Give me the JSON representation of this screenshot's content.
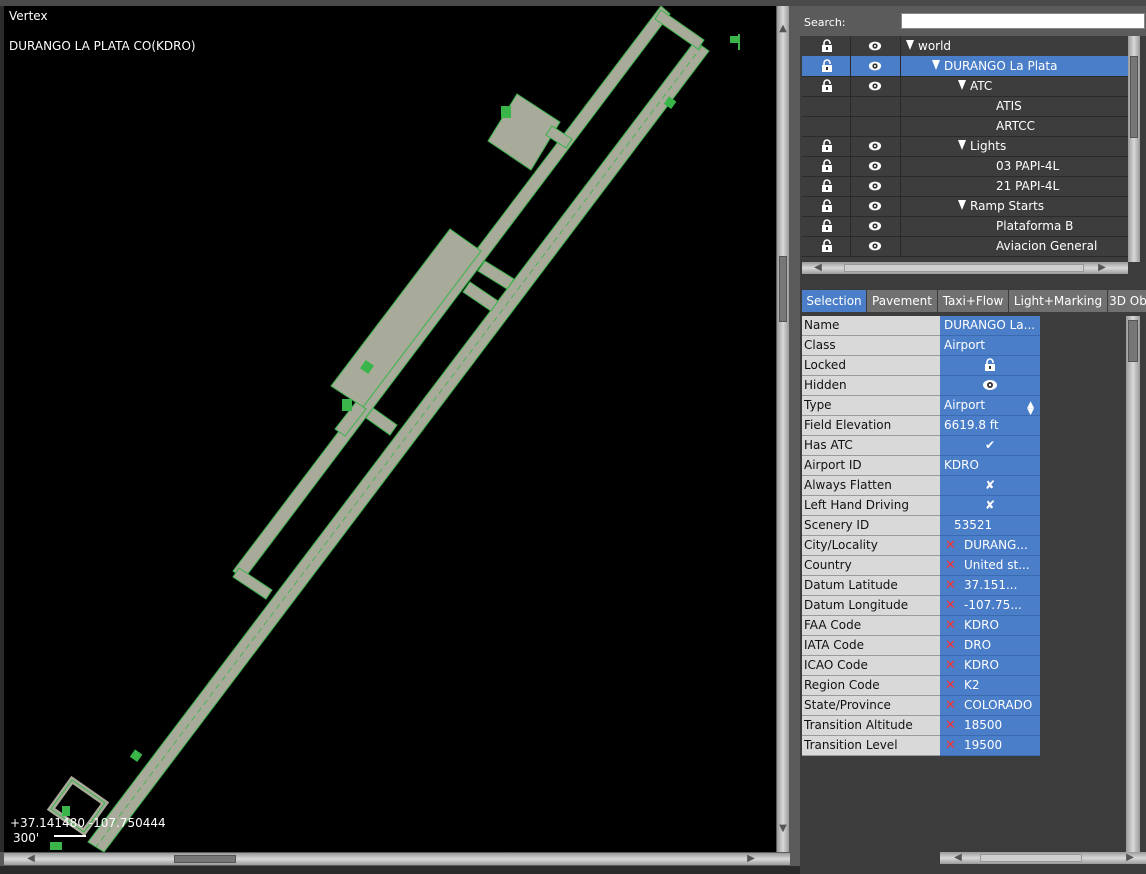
{
  "map": {
    "tool_name": "Vertex",
    "airport_label": "DURANGO LA PLATA CO(KDRO)",
    "cursor_coords": "+37.141480 -107.750444",
    "scale_label": "300'"
  },
  "search": {
    "label": "Search:",
    "value": ""
  },
  "tree": {
    "rows": [
      {
        "label": "world",
        "icons": true,
        "triangle": true,
        "indent": 0,
        "selected": false
      },
      {
        "label": "DURANGO La Plata",
        "icons": true,
        "triangle": true,
        "indent": 1,
        "selected": true
      },
      {
        "label": "ATC",
        "icons": true,
        "triangle": true,
        "indent": 2,
        "selected": false
      },
      {
        "label": "ATIS",
        "icons": false,
        "triangle": false,
        "indent": 3,
        "selected": false
      },
      {
        "label": "ARTCC",
        "icons": false,
        "triangle": false,
        "indent": 3,
        "selected": false
      },
      {
        "label": "Lights",
        "icons": true,
        "triangle": true,
        "indent": 2,
        "selected": false
      },
      {
        "label": "03  PAPI-4L",
        "icons": true,
        "triangle": false,
        "indent": 3,
        "selected": false
      },
      {
        "label": "21  PAPI-4L",
        "icons": true,
        "triangle": false,
        "indent": 3,
        "selected": false
      },
      {
        "label": "Ramp Starts",
        "icons": true,
        "triangle": true,
        "indent": 2,
        "selected": false
      },
      {
        "label": "Plataforma B",
        "icons": true,
        "triangle": false,
        "indent": 3,
        "selected": false
      },
      {
        "label": "Aviacion General",
        "icons": true,
        "triangle": false,
        "indent": 3,
        "selected": false
      }
    ]
  },
  "tabs": [
    {
      "label": "Selection",
      "active": true
    },
    {
      "label": "Pavement",
      "active": false
    },
    {
      "label": "Taxi+Flow",
      "active": false
    },
    {
      "label": "Light+Marking",
      "active": false
    },
    {
      "label": "3D Ob",
      "active": false
    }
  ],
  "properties": [
    {
      "name": "Name",
      "value": "DURANGO La...",
      "kind": "text"
    },
    {
      "name": "Class",
      "value": "Airport",
      "kind": "text"
    },
    {
      "name": "Locked",
      "value": "",
      "kind": "lock"
    },
    {
      "name": "Hidden",
      "value": "",
      "kind": "eye"
    },
    {
      "name": "Type",
      "value": "Airport",
      "kind": "enum"
    },
    {
      "name": "Field Elevation",
      "value": "6619.8 ft",
      "kind": "text"
    },
    {
      "name": "Has ATC",
      "value": "✔",
      "kind": "check"
    },
    {
      "name": "Airport ID",
      "value": "KDRO",
      "kind": "text"
    },
    {
      "name": "Always Flatten",
      "value": "✘",
      "kind": "check"
    },
    {
      "name": "Left Hand Driving",
      "value": "✘",
      "kind": "check"
    },
    {
      "name": "Scenery ID",
      "value": "53521",
      "kind": "indent"
    },
    {
      "name": "City/Locality",
      "value": "DURANG...",
      "kind": "meta"
    },
    {
      "name": "Country",
      "value": "United st...",
      "kind": "meta"
    },
    {
      "name": "Datum Latitude",
      "value": "37.151...",
      "kind": "meta"
    },
    {
      "name": "Datum Longitude",
      "value": "-107.75...",
      "kind": "meta"
    },
    {
      "name": "FAA Code",
      "value": "KDRO",
      "kind": "meta"
    },
    {
      "name": "IATA Code",
      "value": "DRO",
      "kind": "meta"
    },
    {
      "name": "ICAO Code",
      "value": "KDRO",
      "kind": "meta"
    },
    {
      "name": "Region Code",
      "value": "K2",
      "kind": "meta"
    },
    {
      "name": "State/Province",
      "value": "COLORADO",
      "kind": "meta"
    },
    {
      "name": "Transition Altitude",
      "value": "18500",
      "kind": "meta"
    },
    {
      "name": "Transition Level",
      "value": "19500",
      "kind": "meta"
    }
  ],
  "colors": {
    "selection_blue": "#4a7ec8",
    "pavement": "#a8aa9a",
    "edge_green": "#39b54a",
    "delete_red": "#ff3030"
  }
}
